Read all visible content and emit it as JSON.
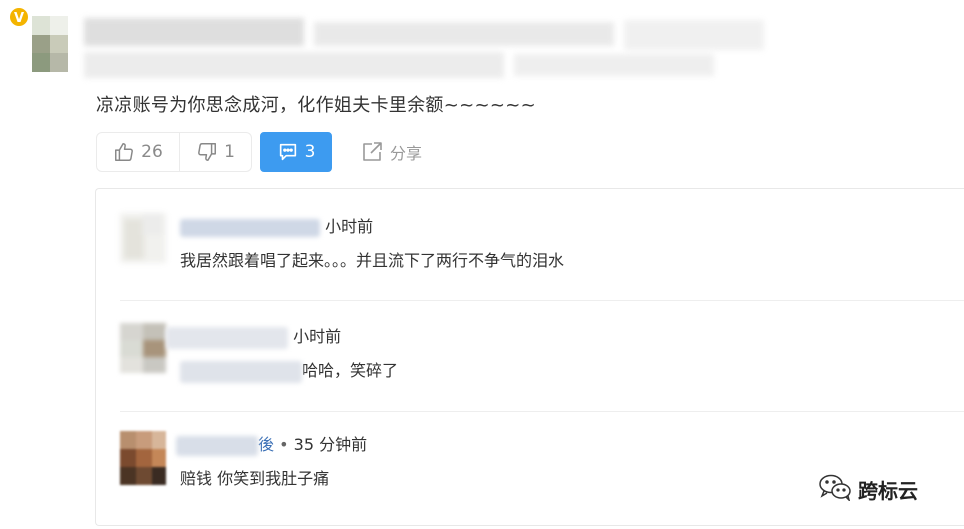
{
  "post": {
    "text": "凉凉账号为你思念成河，化作姐夫卡里余额~~~~~~",
    "badge": "V"
  },
  "actions": {
    "like_count": "26",
    "dislike_count": "1",
    "comment_count": "3",
    "share_label": "分享"
  },
  "replies": [
    {
      "time": "小时前",
      "text": "我居然跟着唱了起来。。。并且流下了两行不争气的泪水"
    },
    {
      "time": "小时前",
      "text": "哈哈，笑碎了"
    },
    {
      "name_tail": "後",
      "separator": "•",
      "time": "35 分钟前",
      "text": "赔钱 你笑到我肚子痛"
    }
  ],
  "watermark": {
    "text": "跨标云"
  },
  "colors": {
    "accent": "#3d9bf0",
    "badge": "#f4b400",
    "link": "#3a6fb5"
  }
}
